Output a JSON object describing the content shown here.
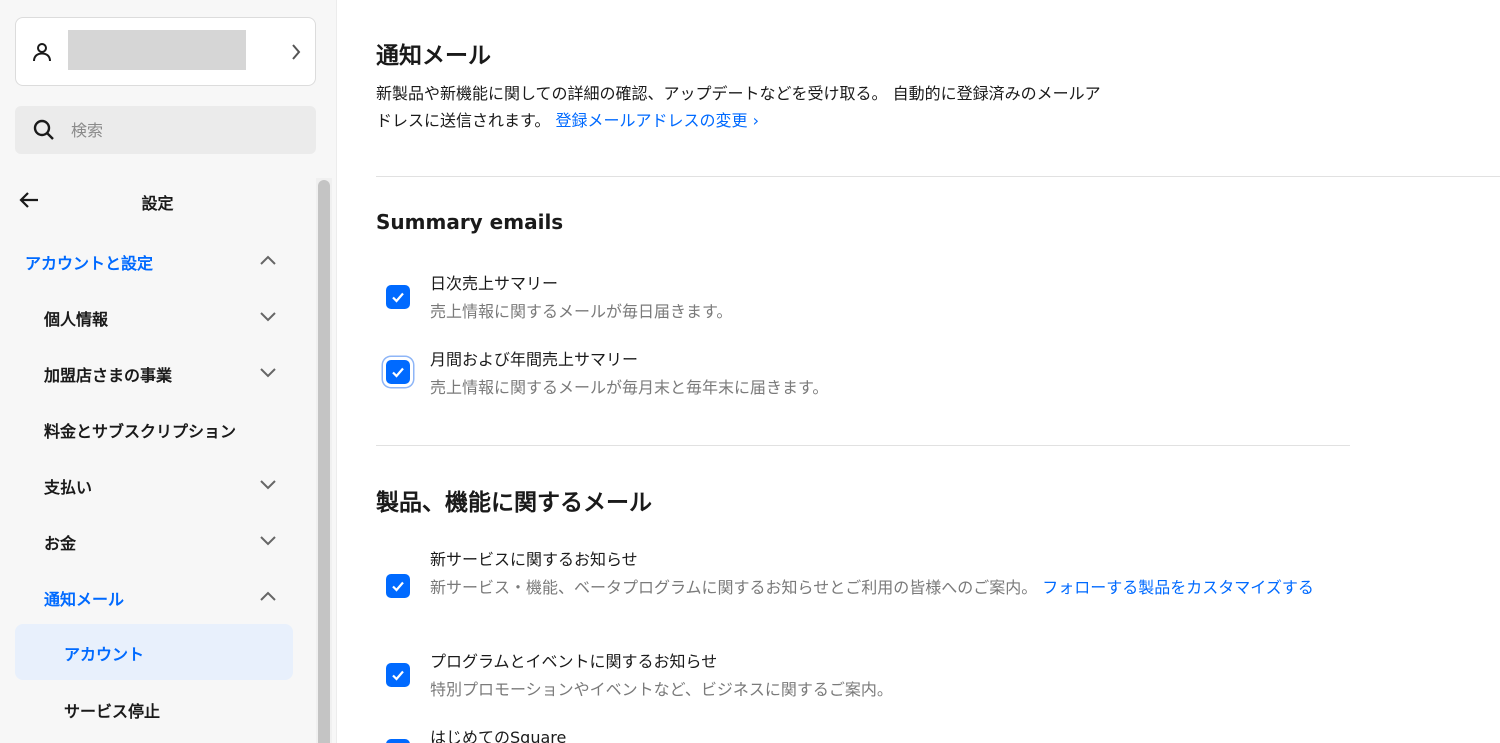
{
  "sidebar": {
    "search_placeholder": "検索",
    "back_title": "設定",
    "items": [
      {
        "label": "アカウントと設定",
        "chevron": "up"
      },
      {
        "label": "個人情報",
        "chevron": "down"
      },
      {
        "label": "加盟店さまの事業",
        "chevron": "down"
      },
      {
        "label": "料金とサブスクリプション",
        "chevron": "none"
      },
      {
        "label": "支払い",
        "chevron": "down"
      },
      {
        "label": "お金",
        "chevron": "down"
      },
      {
        "label": "通知メール",
        "chevron": "up"
      },
      {
        "label": "アカウント",
        "chevron": "none"
      },
      {
        "label": "サービス停止",
        "chevron": "none"
      }
    ]
  },
  "main": {
    "title": "通知メール",
    "description": "新製品や新機能に関しての詳細の確認、アップデートなどを受け取る。 自動的に登録済みのメールアドレスに送信されます。",
    "change_email_link": "登録メールアドレスの変更 ›",
    "summary": {
      "heading": "Summary emails",
      "options": [
        {
          "title": "日次売上サマリー",
          "subtitle": "売上情報に関するメールが毎日届きます。",
          "checked": true
        },
        {
          "title": "月間および年間売上サマリー",
          "subtitle": "売上情報に関するメールが毎月末と毎年末に届きます。",
          "checked": true
        }
      ]
    },
    "product": {
      "heading": "製品、機能に関するメール",
      "options": [
        {
          "title": "新サービスに関するお知らせ",
          "subtitle": "新サービス・機能、ベータプログラムに関するお知らせとご利用の皆様へのご案内。",
          "link": "フォローする製品をカスタマイズする",
          "checked": true
        },
        {
          "title": "プログラムとイベントに関するお知らせ",
          "subtitle": "特別プロモーションやイベントなど、ビジネスに関するご案内。",
          "checked": true
        },
        {
          "title": "はじめてのSquare",
          "checked": true
        }
      ]
    }
  },
  "colors": {
    "accent": "#006aff",
    "sidebar_bg": "#f7f7f7",
    "selected_bg": "#e8f0fc"
  }
}
